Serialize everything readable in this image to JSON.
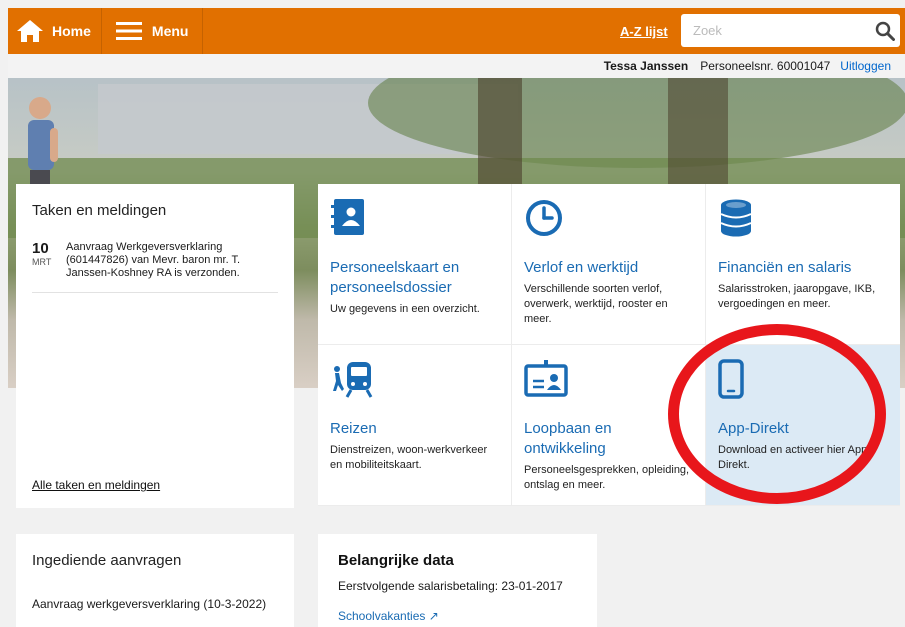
{
  "header": {
    "home_label": "Home",
    "menu_label": "Menu",
    "az_label": "A-Z lijst",
    "search_placeholder": "Zoek",
    "brand_color": "#e17000"
  },
  "userbar": {
    "name": "Tessa Janssen",
    "employee_number": "Personeelsnr. 60001047",
    "logout": "Uitloggen"
  },
  "tasks": {
    "title": "Taken en meldingen",
    "items": [
      {
        "day": "10",
        "month": "MRT",
        "text": "Aanvraag Werkgeversverklaring (601447826) van Mevr. baron mr. T. Janssen-Koshney RA is verzonden."
      }
    ],
    "all_link": "Alle taken en meldingen"
  },
  "tiles": [
    {
      "icon": "address-book-icon",
      "title": "Personeelskaart en personeelsdossier",
      "desc": "Uw gegevens in een overzicht."
    },
    {
      "icon": "clock-icon",
      "title": "Verlof en werktijd",
      "desc": "Verschillende soorten verlof, overwerk, werktijd, rooster en meer."
    },
    {
      "icon": "coins-icon",
      "title": "Financiën en salaris",
      "desc": "Salarisstroken, jaaropgave, IKB, vergoedingen en meer."
    },
    {
      "icon": "travel-icon",
      "title": "Reizen",
      "desc": "Dienstreizen, woon-werkverkeer en mobiliteitskaart."
    },
    {
      "icon": "id-badge-icon",
      "title": "Loopbaan en ontwikkeling",
      "desc": "Personeelsgesprekken, opleiding, ontslag en meer."
    },
    {
      "icon": "smartphone-icon",
      "title": "App-Direkt",
      "desc": "Download en activeer hier App-Direkt."
    }
  ],
  "submitted": {
    "title": "Ingediende aanvragen",
    "item": "Aanvraag werkgeversverklaring (10-3-2022)"
  },
  "important": {
    "title": "Belangrijke data",
    "next_salary": "Eerstvolgende salarisbetaling: 23-01-2017",
    "school_link": "Schoolvakanties ↗"
  },
  "colors": {
    "accent": "#1a6bb3",
    "highlight_tile": "#dceaf5",
    "annotation_circle": "#e8161b"
  }
}
